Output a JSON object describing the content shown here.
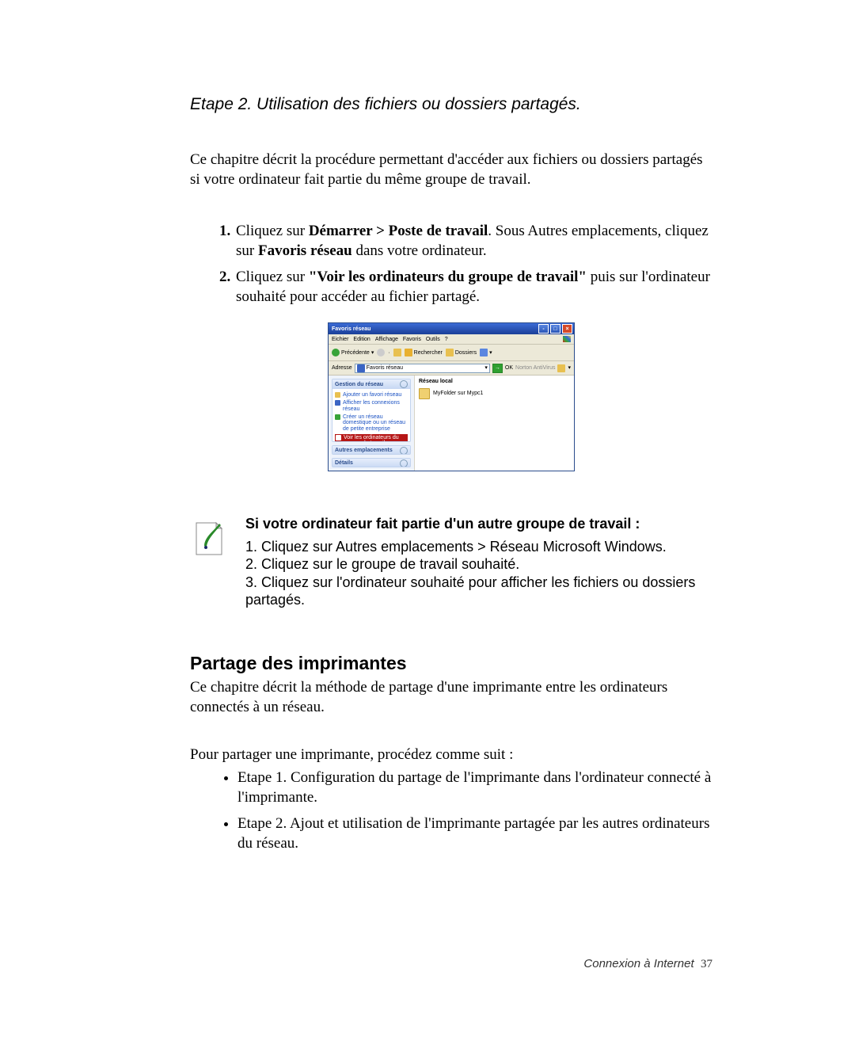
{
  "step_title": "Etape 2. Utilisation des fichiers ou dossiers partagés.",
  "intro": "Ce chapitre décrit la procédure permettant d'accéder aux fichiers ou dossiers partagés si votre ordinateur fait partie du même groupe de travail.",
  "list1": {
    "item1": {
      "pre": "Cliquez sur ",
      "b1": "Démarrer > Poste de travail",
      "mid": ". Sous Autres emplacements, cliquez sur ",
      "b2": "Favoris réseau",
      "post": " dans votre ordinateur."
    },
    "item2": {
      "pre": "Cliquez sur ",
      "b": "\"Voir les ordinateurs du groupe de travail\"",
      "post": " puis sur l'ordinateur souhaité pour accéder au fichier partagé."
    }
  },
  "explorer": {
    "title": "Favoris réseau",
    "menu": {
      "file": "Eichier",
      "edit": "Edition",
      "view": "Affichage",
      "favorites": "Favoris",
      "tools": "Outils",
      "help": "?"
    },
    "tb": {
      "back": "Précédente",
      "search": "Rechercher",
      "folders": "Dossiers"
    },
    "addr": {
      "label": "Adresse",
      "value": "Favoris réseau",
      "ok": "OK",
      "av": "Norton AntiVirus"
    },
    "side": {
      "panel1": "Gestion du réseau",
      "items": {
        "a": "Ajouter un favori réseau",
        "b": "Afficher les connexions réseau",
        "c": "Créer un réseau domestique ou un réseau de petite entreprise",
        "d": "Voir les ordinateurs du groupe de travail"
      },
      "panel2": "Autres emplacements",
      "panel3": "Détails"
    },
    "main": {
      "group": "Réseau local",
      "item": "MyFolder sur Mypc1"
    }
  },
  "note": {
    "heading": "Si votre ordinateur fait partie d'un autre groupe de travail :",
    "line1": "1. Cliquez sur Autres emplacements > Réseau Microsoft Windows.",
    "line2": "2. Cliquez sur le groupe de travail souhaité.",
    "line3": "3. Cliquez sur l'ordinateur souhaité pour afficher les fichiers ou dossiers partagés."
  },
  "section2": {
    "title": "Partage des imprimantes",
    "intro": "Ce chapitre décrit la méthode de partage d'une imprimante entre les ordinateurs connectés à un réseau.",
    "sub": "Pour partager une imprimante, procédez comme suit :",
    "b1": "Etape 1. Configuration du partage de l'imprimante dans l'ordinateur connecté à l'imprimante.",
    "b2": "Etape 2. Ajout et utilisation de l'imprimante partagée par les autres ordinateurs du réseau."
  },
  "footer": {
    "label": "Connexion à Internet",
    "page": "37"
  }
}
